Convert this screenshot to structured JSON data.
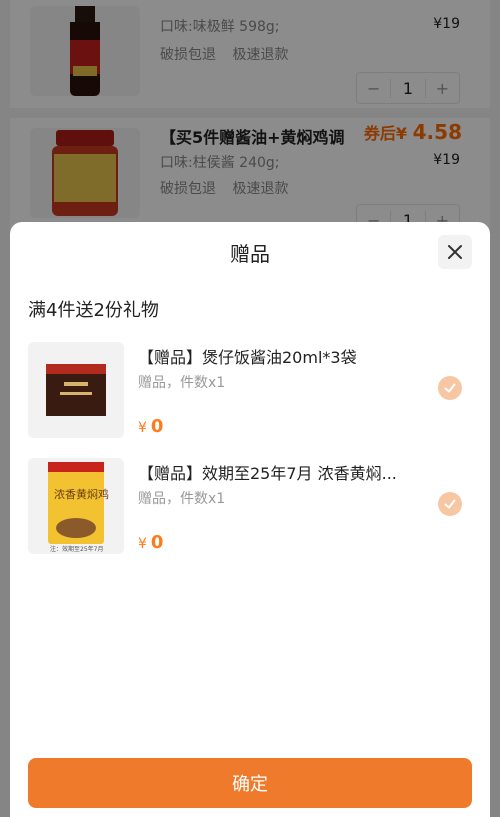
{
  "cart": {
    "items": [
      {
        "flavor": "口味:味极鲜 598g;",
        "price": "¥19",
        "tags": [
          "破损包退",
          "极速退款"
        ],
        "qty": "1",
        "minus": "−",
        "plus": "+"
      },
      {
        "title": "【买5件赠酱油+黄焖鸡调",
        "after_label": "券后¥",
        "after_value": "4.58",
        "flavor": "口味:柱侯酱 240g;",
        "price": "¥19",
        "tags": [
          "破损包退",
          "极速退款"
        ],
        "qty": "1",
        "minus": "−",
        "plus": "+"
      }
    ],
    "brand_labels": {
      "bottle": "味极鲜",
      "jar_brand": "大厨来",
      "jar_name": "柱侯酱"
    }
  },
  "sheet": {
    "title": "赠品",
    "rule": "满4件送2份礼物",
    "gifts": [
      {
        "title": "【赠品】煲仔饭酱油20ml*3袋",
        "sub": "赠品，件数x1",
        "currency": "¥",
        "price": "0",
        "checked": true
      },
      {
        "title": "【赠品】效期至25年7月 浓香黄焖...",
        "sub": "赠品，件数x1",
        "currency": "¥",
        "price": "0",
        "checked": true,
        "pack_text": "浓香黄焖鸡",
        "pack_note": "注：效期至25年7月"
      }
    ],
    "confirm_label": "确定"
  },
  "colors": {
    "accent": "#f07a2b",
    "price": "#ff7a1a",
    "check": "#f7c7a3"
  }
}
